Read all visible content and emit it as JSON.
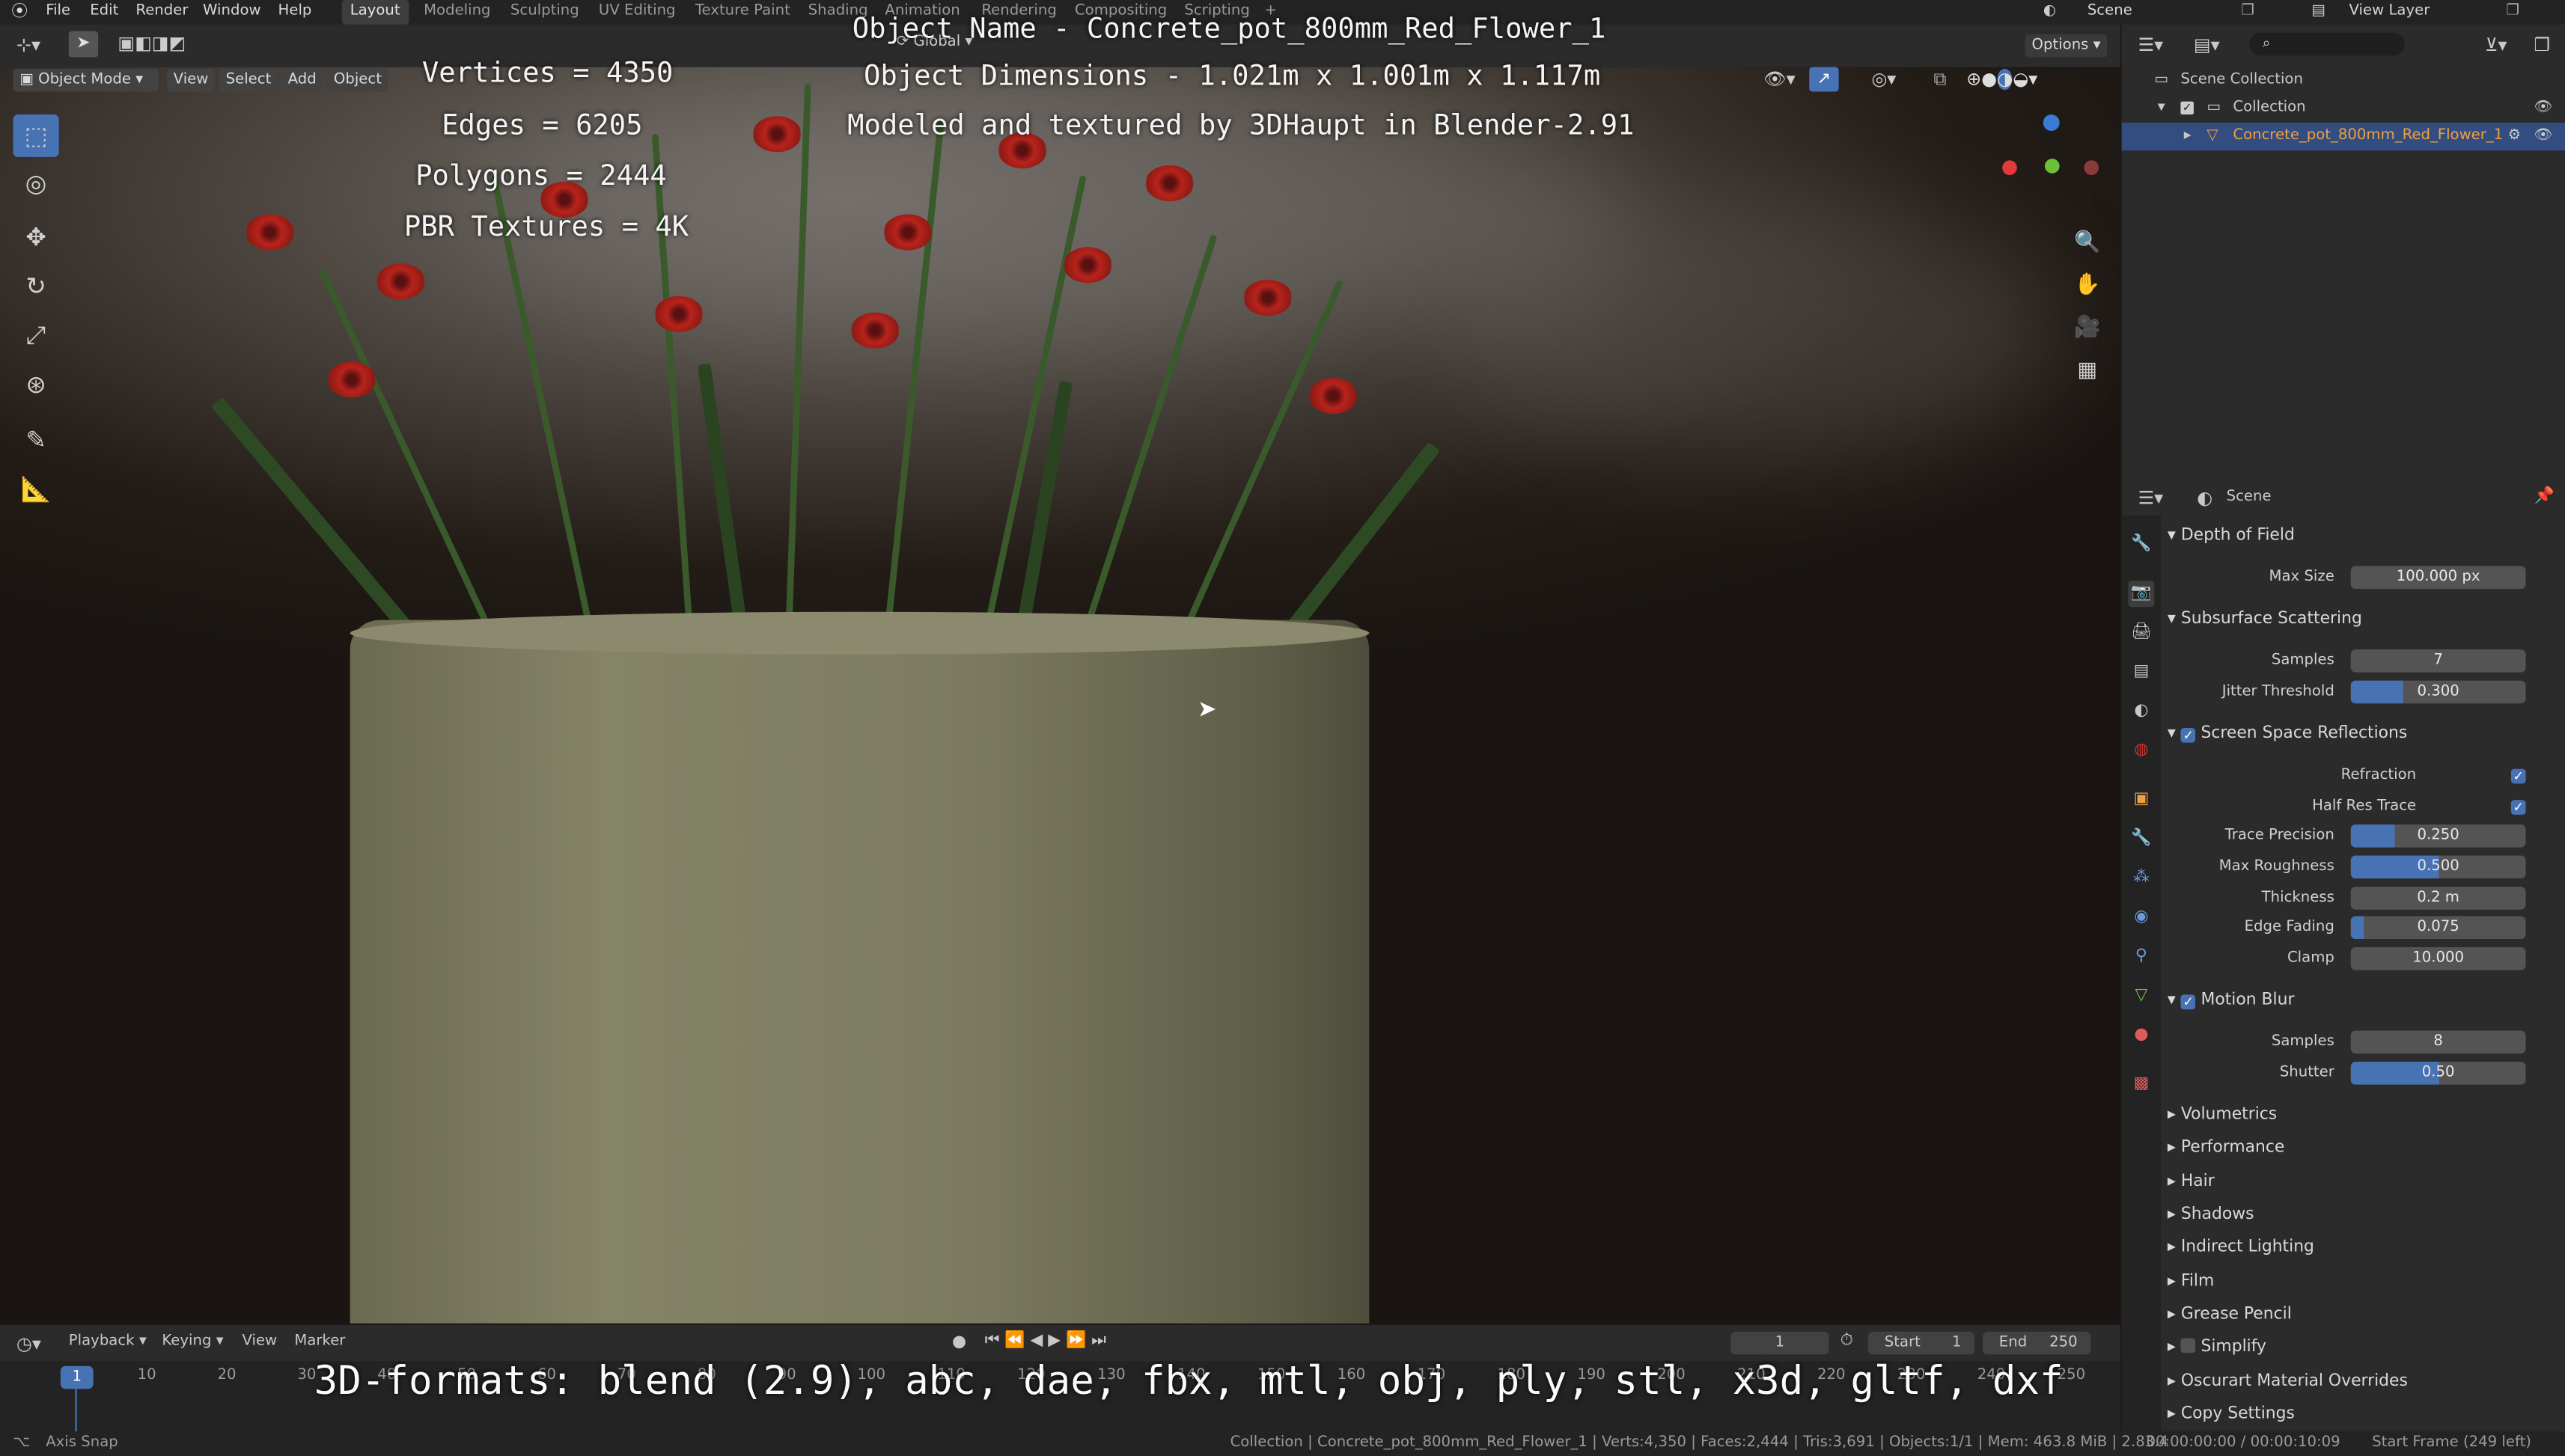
{
  "menu": {
    "items": [
      "File",
      "Edit",
      "Render",
      "Window",
      "Help"
    ],
    "workspaces": [
      "Layout",
      "Modeling",
      "Sculpting",
      "UV Editing",
      "Texture Paint",
      "Shading",
      "Animation",
      "Rendering",
      "Compositing",
      "Scripting",
      "+"
    ],
    "scene_label": "Scene",
    "view_layer_label": "View Layer"
  },
  "viewport_header": {
    "transform_orientation": "Global",
    "options": "Options",
    "mode": "Object Mode",
    "view": "View",
    "select": "Select",
    "add": "Add",
    "object": "Object"
  },
  "overlay": {
    "vertices": "Vertices = 4350",
    "edges": "Edges = 6205",
    "polygons": "Polygons = 2444",
    "textures": "PBR Textures = 4K",
    "object_name": "Object Name - Concrete_pot_800mm_Red_Flower_1",
    "dimensions": "Object Dimensions -  1.021m x 1.001m x 1.117m",
    "credit": "Modeled and textured by 3DHaupt in Blender-2.91",
    "formats": "3D-formats: blend (2.9), abc, dae, fbx, mtl, obj, ply, stl, x3d, gltf, dxf"
  },
  "outliner": {
    "scene_collection": "Scene Collection",
    "collection": "Collection",
    "object": "Concrete_pot_800mm_Red_Flower_1"
  },
  "properties": {
    "context": "Scene",
    "depth_of_field": {
      "title": "Depth of Field",
      "max_size_label": "Max Size",
      "max_size": "100.000 px"
    },
    "sss": {
      "title": "Subsurface Scattering",
      "samples_label": "Samples",
      "samples": "7",
      "jitter_label": "Jitter Threshold",
      "jitter": "0.300",
      "jitter_frac": 0.3
    },
    "ssr": {
      "title": "Screen Space Reflections",
      "refraction_label": "Refraction",
      "half_res_label": "Half Res Trace",
      "trace_precision_label": "Trace Precision",
      "trace_precision": "0.250",
      "trace_precision_frac": 0.25,
      "max_roughness_label": "Max Roughness",
      "max_roughness": "0.500",
      "max_roughness_frac": 0.5,
      "thickness_label": "Thickness",
      "thickness": "0.2 m",
      "edge_fading_label": "Edge Fading",
      "edge_fading": "0.075",
      "edge_fading_frac": 0.075,
      "clamp_label": "Clamp",
      "clamp": "10.000"
    },
    "motion_blur": {
      "title": "Motion Blur",
      "samples_label": "Samples",
      "samples": "8",
      "shutter_label": "Shutter",
      "shutter": "0.50",
      "shutter_frac": 0.5
    },
    "collapsed": [
      "Volumetrics",
      "Performance",
      "Hair",
      "Shadows",
      "Indirect Lighting",
      "Film",
      "Grease Pencil",
      "Simplify",
      "Oscurart Material Overrides",
      "Copy Settings"
    ]
  },
  "timeline": {
    "playback": "Playback",
    "keying": "Keying",
    "view": "View",
    "marker": "Marker",
    "current_frame": "1",
    "start_label": "Start",
    "start": "1",
    "end_label": "End",
    "end": "250",
    "ticks": [
      "1",
      "10",
      "20",
      "30",
      "40",
      "50",
      "60",
      "70",
      "80",
      "90",
      "100",
      "110",
      "120",
      "130",
      "140",
      "150",
      "160",
      "170",
      "180",
      "190",
      "200",
      "210",
      "220",
      "230",
      "240",
      "250"
    ]
  },
  "status": {
    "left": "Axis Snap",
    "center": "Collection | Concrete_pot_800mm_Red_Flower_1 | Verts:4,350 | Faces:2,444 | Tris:3,691 | Objects:1/1 | Mem: 463.8 MiB | 2.83.4",
    "time": "00:00:00:00 / 00:00:10:09",
    "start_frame": "Start Frame (249 left)"
  },
  "colors": {
    "accent": "#4772b3",
    "flower": "#b8231c",
    "outliner_highlight": "#334d80"
  }
}
